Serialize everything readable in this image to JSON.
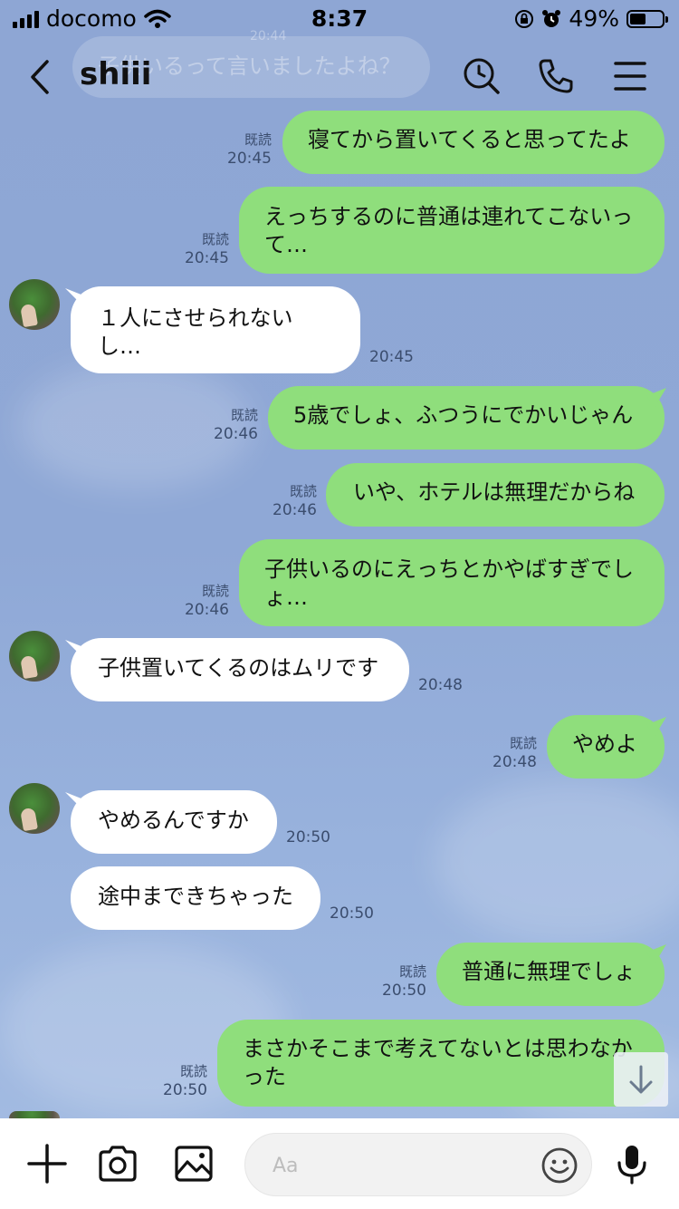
{
  "status_bar": {
    "carrier": "docomo",
    "time": "8:37",
    "battery": "49%",
    "battery_level": 0.49
  },
  "header": {
    "contact_name": "shiii",
    "ghost_message": "子供いるって言いましたよね？",
    "ghost_time": "20:44"
  },
  "messages": [
    {
      "dir": "out",
      "text": "寝てから置いてくると思ってたよ",
      "read": "既読",
      "time": "20:45"
    },
    {
      "dir": "out",
      "text": "えっちするのに普通は連れてこないって…",
      "read": "既読",
      "time": "20:45"
    },
    {
      "dir": "in",
      "text": "１人にさせられないし…",
      "time": "20:45"
    },
    {
      "dir": "out",
      "text": "5歳でしょ、ふつうにでかいじゃん",
      "read": "既読",
      "time": "20:46"
    },
    {
      "dir": "out",
      "text": "いや、ホテルは無理だからね",
      "read": "既読",
      "time": "20:46"
    },
    {
      "dir": "out",
      "text": "子供いるのにえっちとかやばすぎでしょ…",
      "read": "既読",
      "time": "20:46"
    },
    {
      "dir": "in",
      "text": "子供置いてくるのはムリです",
      "time": "20:48"
    },
    {
      "dir": "out",
      "text": "やめよ",
      "read": "既読",
      "time": "20:48"
    },
    {
      "dir": "in",
      "text": "やめるんですか",
      "time": "20:50"
    },
    {
      "dir": "in",
      "text": "途中まできちゃった",
      "time": "20:50"
    },
    {
      "dir": "out",
      "text": "普通に無理でしょ",
      "read": "既読",
      "time": "20:50"
    },
    {
      "dir": "out",
      "text": "まさかそこまで考えてないとは思わなかった",
      "read": "既読",
      "time": "20:50"
    }
  ],
  "input": {
    "placeholder": "Aa"
  },
  "colors": {
    "outgoing_bubble": "#8fde7c",
    "incoming_bubble": "#ffffff",
    "background": "#8fa8d6"
  },
  "icons": {
    "back": "chevron-left-icon",
    "search": "search-clock-icon",
    "call": "phone-icon",
    "menu": "hamburger-menu-icon",
    "add": "plus-icon",
    "camera": "camera-icon",
    "image": "image-icon",
    "emoji": "smile-icon",
    "mic": "mic-icon",
    "scroll_down": "arrow-down-icon"
  }
}
